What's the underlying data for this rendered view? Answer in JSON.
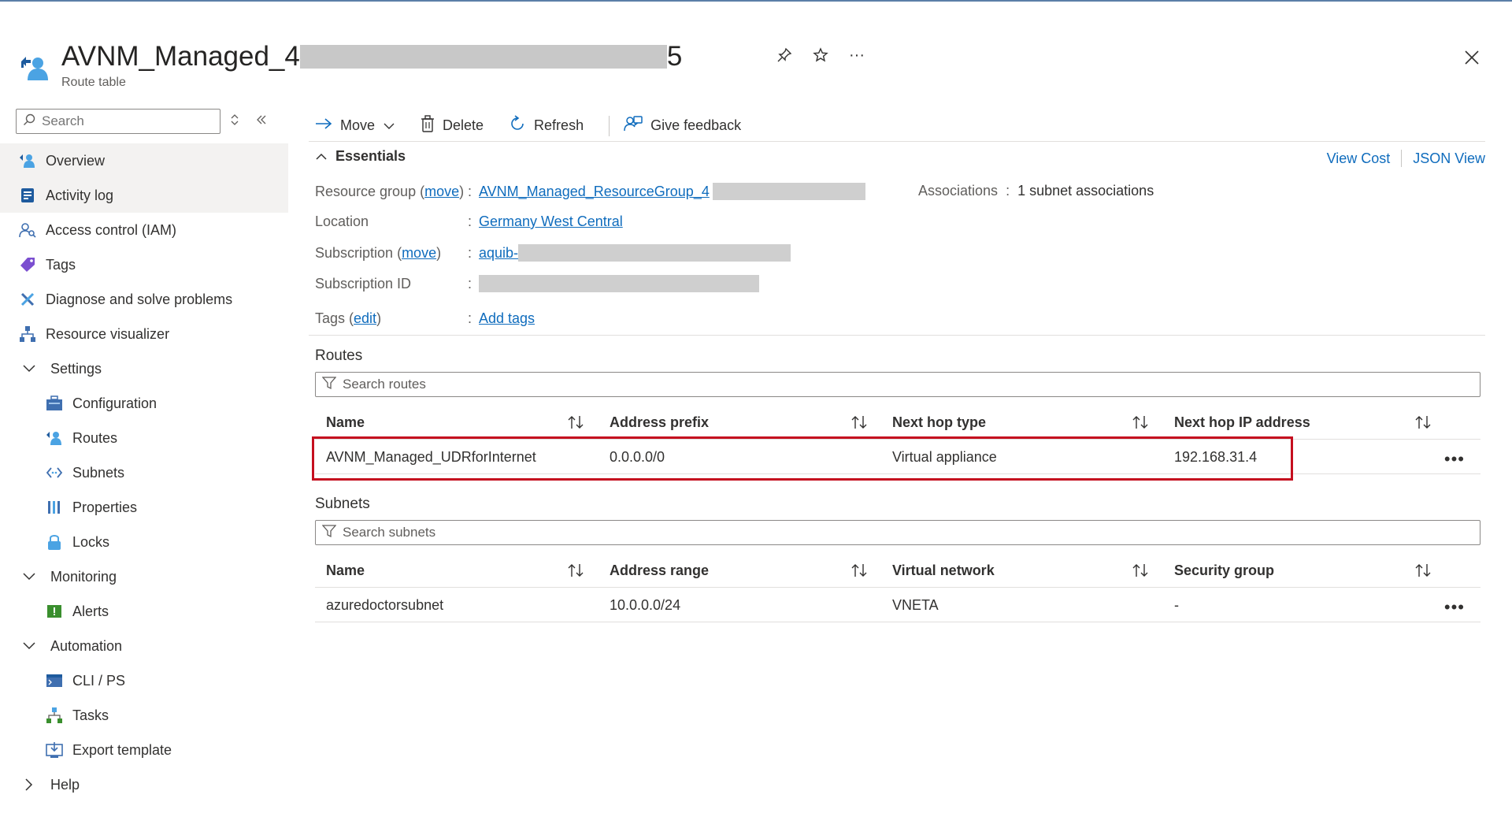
{
  "header": {
    "title_prefix": "AVNM_Managed_4",
    "title_suffix": "5",
    "subtitle": "Route table",
    "more_label": "···"
  },
  "sidebar": {
    "search_placeholder": "Search",
    "items": [
      {
        "label": "Overview",
        "icon": "overview-icon",
        "indent": false,
        "active": true
      },
      {
        "label": "Activity log",
        "icon": "activity-log-icon",
        "indent": false,
        "hl": true
      },
      {
        "label": "Access control (IAM)",
        "icon": "iam-icon",
        "indent": false
      },
      {
        "label": "Tags",
        "icon": "tag-icon",
        "indent": false
      },
      {
        "label": "Diagnose and solve problems",
        "icon": "wrench-icon",
        "indent": false
      },
      {
        "label": "Resource visualizer",
        "icon": "visualizer-icon",
        "indent": false
      },
      {
        "label": "Settings",
        "icon": "chevron-down-icon",
        "group": true
      },
      {
        "label": "Configuration",
        "icon": "configuration-icon",
        "indent": true
      },
      {
        "label": "Routes",
        "icon": "routes-icon",
        "indent": true
      },
      {
        "label": "Subnets",
        "icon": "subnets-icon",
        "indent": true
      },
      {
        "label": "Properties",
        "icon": "properties-icon",
        "indent": true
      },
      {
        "label": "Locks",
        "icon": "lock-icon",
        "indent": true
      },
      {
        "label": "Monitoring",
        "icon": "chevron-down-icon",
        "group": true
      },
      {
        "label": "Alerts",
        "icon": "alert-icon",
        "indent": true
      },
      {
        "label": "Automation",
        "icon": "chevron-down-icon",
        "group": true
      },
      {
        "label": "CLI / PS",
        "icon": "cli-icon",
        "indent": true
      },
      {
        "label": "Tasks",
        "icon": "tasks-icon",
        "indent": true
      },
      {
        "label": "Export template",
        "icon": "export-icon",
        "indent": true
      },
      {
        "label": "Help",
        "icon": "chevron-right-icon",
        "group": true
      }
    ]
  },
  "toolbar": {
    "move": "Move",
    "delete": "Delete",
    "refresh": "Refresh",
    "feedback": "Give feedback"
  },
  "essentials": {
    "title": "Essentials",
    "view_cost": "View Cost",
    "json_view": "JSON View",
    "resource_group_label": "Resource group",
    "move_link": "move",
    "resource_group_value": "AVNM_Managed_ResourceGroup_4",
    "location_label": "Location",
    "location_value": "Germany West Central",
    "subscription_label": "Subscription",
    "subscription_value": "aquib-",
    "subscription_id_label": "Subscription ID",
    "tags_label": "Tags",
    "edit_link": "edit",
    "tags_value": "Add tags",
    "associations_label": "Associations",
    "associations_value": "1 subnet associations",
    "colon": ":"
  },
  "routes": {
    "title": "Routes",
    "search_placeholder": "Search routes",
    "columns": [
      "Name",
      "Address prefix",
      "Next hop type",
      "Next hop IP address"
    ],
    "rows": [
      [
        "AVNM_Managed_UDRforInternet",
        "0.0.0.0/0",
        "Virtual appliance",
        "192.168.31.4"
      ]
    ]
  },
  "subnets": {
    "title": "Subnets",
    "search_placeholder": "Search subnets",
    "columns": [
      "Name",
      "Address range",
      "Virtual network",
      "Security group"
    ],
    "rows": [
      [
        "azuredoctorsubnet",
        "10.0.0.0/24",
        "VNETA",
        "-"
      ]
    ]
  },
  "colors": {
    "link": "#0f6cbd",
    "highlight": "#c50f1f"
  }
}
